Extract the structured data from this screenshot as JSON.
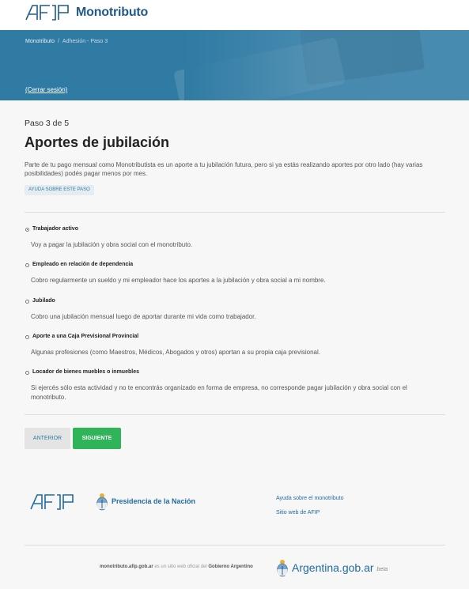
{
  "header": {
    "logo_text": "AFIP",
    "brand": "Monotributo"
  },
  "hero": {
    "breadcrumb": [
      "Monotributo",
      "Adhesión - Paso 3"
    ],
    "breadcrumb_sep": "/",
    "logout": "(Cerrar sesión)"
  },
  "main": {
    "step": "Paso 3 de 5",
    "title": "Aportes de jubilación",
    "intro": "Parte de tu pago mensual como Monotributista es un aporte a tu jubilación futura, pero si ya estás realizando aportes por otro lado (hay varias posibilidades) podés pagar menos por mes.",
    "help_button": "AYUDA SOBRE ESTE PASO",
    "options": [
      {
        "label": "Trabajador activo",
        "desc": "Voy a pagar la jubilación y obra social con el monotributo.",
        "selected": true
      },
      {
        "label": "Empleado en relación de dependencia",
        "desc": "Cobro regularmente un sueldo y mi empleador hace los aportes a la jubilación y obra social a mi nombre.",
        "selected": false
      },
      {
        "label": "Jubilado",
        "desc": "Cobro una jubilación mensual luego de aportar durante mi vida como trabajador.",
        "selected": false
      },
      {
        "label": "Aporte a una Caja Previsional Provincial",
        "desc": "Algunas profesiones (como Maestros, Médicos, Abogados y otros) aportan a su propia caja previsional.",
        "selected": false
      },
      {
        "label": "Locador de bienes muebles o inmuebles",
        "desc": "Si ejercés sólo esta actividad y no te encontrás organizado en forma de empresa, no corresponde pagar jubilación y obra social con el monotributo.",
        "selected": false
      }
    ],
    "prev_button": "ANTERIOR",
    "next_button": "SIGUIENTE"
  },
  "footer": {
    "afip_logo_text": "AFIP",
    "presidencia": "Presidencia de la Nación",
    "links": [
      "Ayuda sobre el monotributo",
      "Sitio web de AFIP"
    ],
    "note_site": "monotributo.afip.gob.ar",
    "note_mid": " es un sitio web oficial del ",
    "note_gov": "Gobierno Argentino",
    "argentina": "Argentina.gob.ar",
    "beta": "beta"
  },
  "colors": {
    "primary": "#2f7ba3",
    "brand": "#1f5a8a",
    "next": "#2fb45a",
    "link": "#1f6aa5"
  }
}
